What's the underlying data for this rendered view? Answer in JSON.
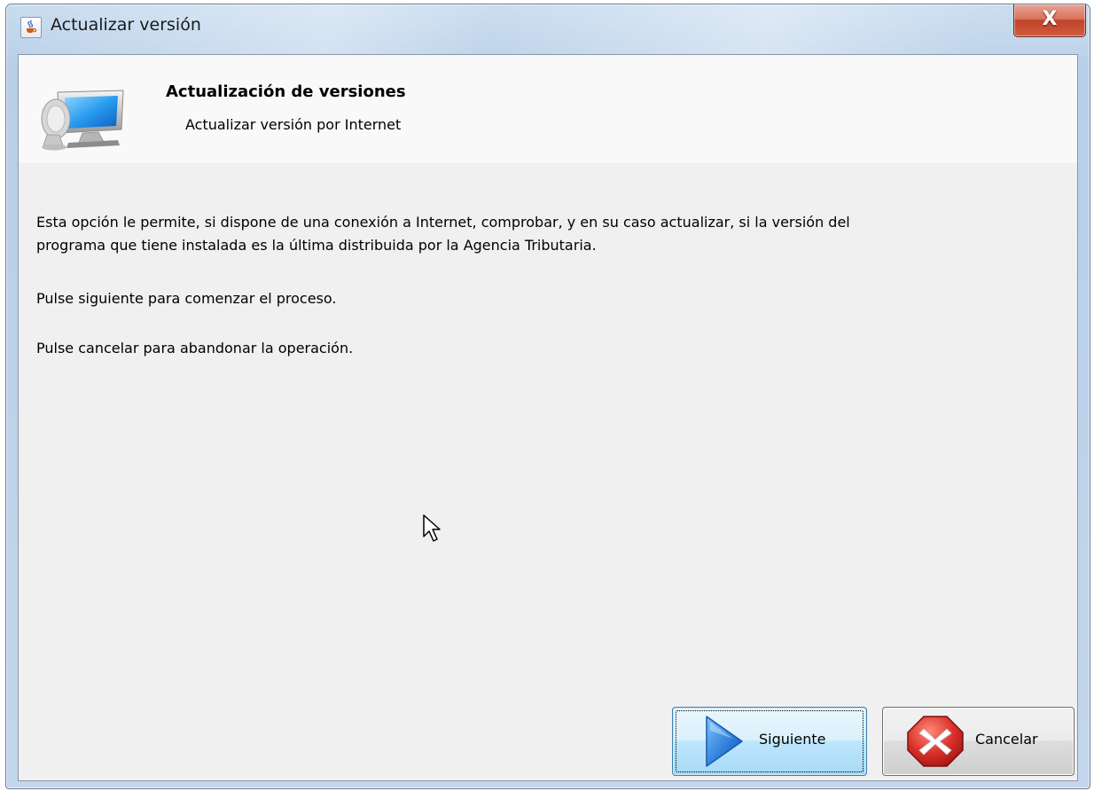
{
  "window": {
    "title": "Actualizar versión",
    "close_symbol": "X",
    "app_icon": "java-cup-icon"
  },
  "header": {
    "title": "Actualización de versiones",
    "subtitle": "Actualizar versión por Internet",
    "icon": "computer-monitor-icon"
  },
  "body": {
    "paragraph_1_line_1": "Esta opción le permite, si dispone de una conexión a Internet, comprobar, y en su caso actualizar, si la versión del",
    "paragraph_1_line_2": "programa que tiene instalada es la última distribuida por la Agencia Tributaria.",
    "paragraph_2": "Pulse siguiente para comenzar el proceso.",
    "paragraph_3": "Pulse cancelar para abandonar la operación."
  },
  "buttons": {
    "next_label": "Siguiente",
    "next_icon": "play-arrow-icon",
    "cancel_label": "Cancelar",
    "cancel_icon": "red-x-icon"
  },
  "colors": {
    "close_button": "#c0432a",
    "next_arrow": "#2b7bd8",
    "cancel_icon": "#d9302a",
    "client_background": "#f0f0f0"
  }
}
